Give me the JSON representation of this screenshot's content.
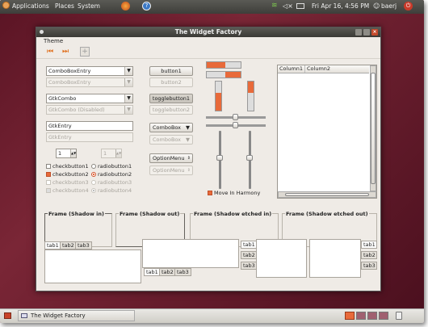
{
  "topbar": {
    "menu_applications": "Applications",
    "menu_places": "Places",
    "menu_system": "System",
    "clock": "Fri Apr 16,  4:56 PM",
    "user": "baerj"
  },
  "window": {
    "title": "The Widget Factory",
    "menu_theme": "Theme",
    "combos": {
      "combobox_entry": "ComboBoxEntry",
      "combobox_entry_dis": "ComboBoxEntry",
      "gtkcombo": "GtkCombo",
      "gtkcombo_dis": "GtkCombo (Disabled)",
      "gtkentry": "GtkEntry",
      "gtkentry_dis": "GtkEntry",
      "spin1": "1",
      "spin2": "1"
    },
    "checks": {
      "cb1": "checkbutton1",
      "cb2": "checkbutton2",
      "cb3": "checkbutton3",
      "cb4": "checkbutton4",
      "rb1": "radiobutton1",
      "rb2": "radiobutton2",
      "rb3": "radiobutton3",
      "rb4": "radiobutton4"
    },
    "buttons": {
      "button1": "button1",
      "button2": "button2",
      "toggle1": "togglebutton1",
      "toggle2": "togglebutton2",
      "combobox": "ComboBox",
      "combobox_dis": "ComboBox",
      "optionmenu": "OptionMenu",
      "optionmenu_dis": "OptionMenu"
    },
    "progress": {
      "h1": 0.55,
      "h2": 0.45,
      "v1": 0.6,
      "v2": 0.4
    },
    "move_in_harmony": "Move In Harmony",
    "columns": [
      "Column1",
      "Column2"
    ],
    "frames": [
      "Frame (Shadow in)",
      "Frame (Shadow out)",
      "Frame (Shadow etched in)",
      "Frame (Shadow etched out)"
    ],
    "tabs": [
      "tab1",
      "tab2",
      "tab3"
    ]
  },
  "taskbar": {
    "window_label": "The Widget Factory"
  },
  "colors": {
    "accent": "#e86a3a",
    "wallpaper": "#6a1e2e",
    "panel": "#4a4a46"
  }
}
